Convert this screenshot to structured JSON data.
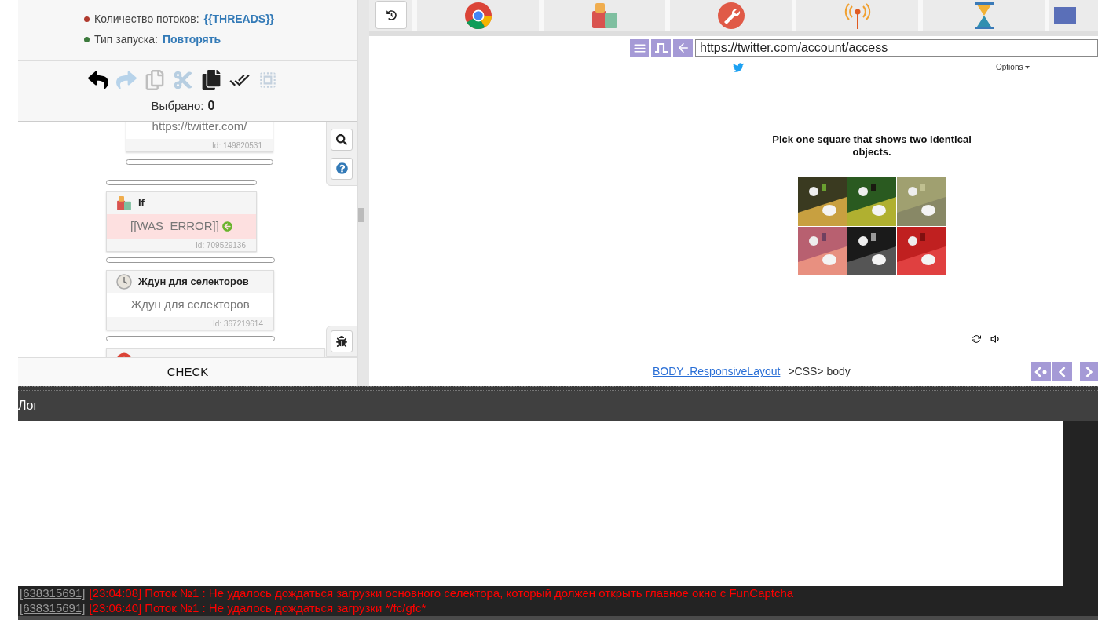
{
  "launch_info": [
    {
      "label": "Количество потоков:",
      "value": "{{THREADS}}",
      "color": "#b03a2e"
    },
    {
      "label": "Тип запуска:",
      "value": "Повторять",
      "color": "#3c7a3c"
    }
  ],
  "toolbar": [
    {
      "kind": "undo",
      "disabled": false
    },
    {
      "kind": "redo",
      "disabled": true
    },
    {
      "kind": "copy",
      "disabled": true
    },
    {
      "kind": "cut",
      "disabled": true
    },
    {
      "kind": "paste",
      "disabled": false
    },
    {
      "kind": "check",
      "disabled": false
    },
    {
      "kind": "select",
      "disabled": true
    }
  ],
  "selection": {
    "label": "Выбрано:",
    "count": "0"
  },
  "nodes": [
    {
      "kind": "action",
      "body": "https://twitter.com/",
      "id": "Id: 149820531"
    },
    {
      "kind": "if",
      "title": "If",
      "body": "[[WAS_ERROR]]",
      "id": "Id: 709529136"
    },
    {
      "kind": "wait",
      "title": "Ждун для селекторов",
      "body": "Ждун для селекторов",
      "id": "Id: 367219614"
    },
    {
      "kind": "browser"
    }
  ],
  "check_button": "CHECK",
  "browser": {
    "url": "https://twitter.com/account/access",
    "options": "Options",
    "captcha_title": "Pick one square that shows two identical objects.",
    "breadcrumb_link": "BODY .ResponsiveLayout",
    "breadcrumb_rest": ">CSS> body"
  },
  "log": {
    "title": "Лог",
    "lines": [
      {
        "source": "[638315691]",
        "time": "[23:04:08]",
        "message": "Поток №1 : Не удалось дождаться загрузки основного селектора, который должен открыть главное окно с FunCaptcha"
      },
      {
        "source": "[638315691]",
        "time": "[23:06:40]",
        "message": "Поток №1 : Не удалось дождаться загрузки */fc/gfc*"
      }
    ]
  }
}
